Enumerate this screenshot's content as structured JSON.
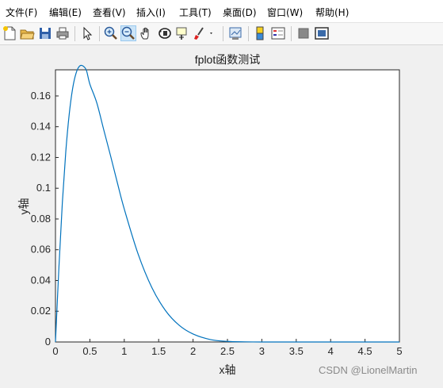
{
  "menu": [
    "文件(F)",
    "编辑(E)",
    "查看(V)",
    "插入(I)",
    "工具(T)",
    "桌面(D)",
    "窗口(W)",
    "帮助(H)"
  ],
  "toolbar_icons": [
    "new-file-icon",
    "open-folder-icon",
    "save-icon",
    "print-icon",
    "pointer-icon",
    "zoom-in-icon",
    "zoom-out-icon",
    "pan-hand-icon",
    "rotate-3d-icon",
    "data-cursor-icon",
    "brush-icon",
    "link-plot-icon",
    "colorbar-icon",
    "legend-icon",
    "hide-plot-tools-icon",
    "show-plot-tools-icon"
  ],
  "colors": {
    "line": "#0072bd",
    "axes_bg": "#ffffff",
    "figure_bg": "#f0f0f0"
  },
  "watermark": "CSDN @LionelMartin",
  "chart_data": {
    "type": "line",
    "title": "fplot函数测试",
    "xlabel": "x轴",
    "ylabel": "y轴",
    "xlim": [
      0,
      5
    ],
    "ylim": [
      0,
      0.177
    ],
    "xticks": [
      "0",
      "0.5",
      "1",
      "1.5",
      "2",
      "2.5",
      "3",
      "3.5",
      "4",
      "4.5",
      "5"
    ],
    "yticks": [
      "0",
      "0.02",
      "0.04",
      "0.06",
      "0.08",
      "0.1",
      "0.12",
      "0.14",
      "0.16"
    ],
    "grid": false,
    "series": [
      {
        "x": [
          0,
          0.05,
          0.1,
          0.15,
          0.2,
          0.25,
          0.3,
          0.35,
          0.4,
          0.45,
          0.5,
          0.6,
          0.7,
          0.8,
          0.9,
          1.0,
          1.2,
          1.4,
          1.6,
          1.8,
          2.0,
          2.25,
          2.5,
          2.75,
          3.0,
          3.25,
          3.5,
          4.0,
          4.5,
          5.0
        ],
        "y": [
          0,
          0.0485,
          0.0907,
          0.1238,
          0.1482,
          0.165,
          0.1749,
          0.1794,
          0.1795,
          0.1766,
          0.1677,
          0.1556,
          0.1383,
          0.1212,
          0.1035,
          0.0865,
          0.0574,
          0.0355,
          0.0204,
          0.0108,
          0.0052,
          0.0016,
          0.0004,
          0.0001,
          0,
          0,
          0,
          0,
          0,
          0
        ]
      }
    ]
  }
}
